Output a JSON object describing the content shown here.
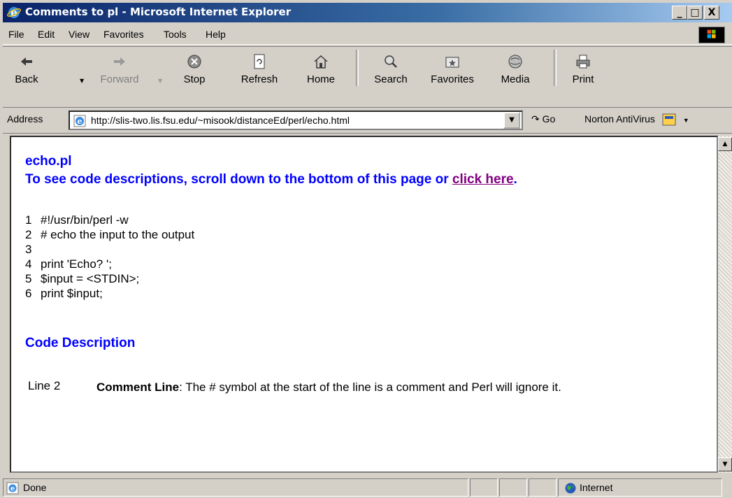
{
  "window": {
    "title": "Comments to pl - Microsoft Internet Explorer",
    "min_label": "_",
    "max_label": "□",
    "close_label": "X"
  },
  "menu": [
    "File",
    "Edit",
    "View",
    "Favorites",
    "Tools",
    "Help"
  ],
  "toolbar": {
    "back": "Back",
    "forward": "Forward",
    "stop": "Stop",
    "refresh": "Refresh",
    "home": "Home",
    "search": "Search",
    "favorites": "Favorites",
    "media": "Media",
    "print": "Print"
  },
  "address": {
    "label": "Address",
    "url": "http://slis-two.lis.fsu.edu/~misook/distanceEd/perl/echo.html",
    "go": "Go",
    "norton": "Norton AntiVirus"
  },
  "page": {
    "heading": "echo.pl",
    "note_prefix": "To see code descriptions, scroll down to the bottom of this page or ",
    "note_link": "click here",
    "note_suffix": ".",
    "code_lines": [
      {
        "num": "1",
        "text": "#!/usr/bin/perl -w"
      },
      {
        "num": "2",
        "text": "# echo the input to the output"
      },
      {
        "num": "3",
        "text": ""
      },
      {
        "num": "4",
        "text": "print 'Echo? ';"
      },
      {
        "num": "5",
        "text": "$input = <STDIN>;"
      },
      {
        "num": "6",
        "text": "print $input;"
      }
    ],
    "desc_heading": "Code Description",
    "desc_line_label": "Line 2",
    "desc_term": "Comment Line",
    "desc_text": ": The # symbol at the start of the line is a comment and Perl will ignore it."
  },
  "status": {
    "text": "Done",
    "zone": "Internet"
  }
}
